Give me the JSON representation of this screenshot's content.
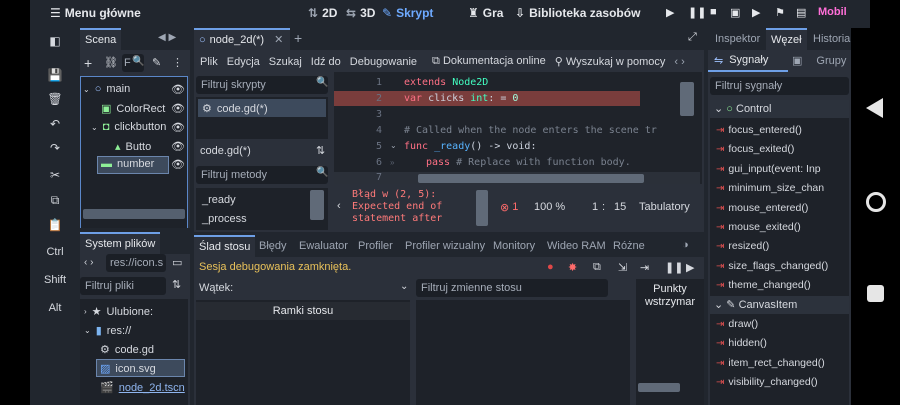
{
  "topbar": {
    "menu_label": "Menu główne",
    "tabs": [
      {
        "label": "2D"
      },
      {
        "label": "3D"
      },
      {
        "label": "Skrypt"
      },
      {
        "label": "Gra"
      },
      {
        "label": "Biblioteka zasobów"
      }
    ],
    "run_label": "Mobil"
  },
  "left_tools": {
    "ctrl": "Ctrl",
    "shift": "Shift",
    "alt": "Alt"
  },
  "scene": {
    "tab": "Scena",
    "tree": [
      {
        "label": "main"
      },
      {
        "label": "ColorRect"
      },
      {
        "label": "clickbutton"
      },
      {
        "label": "Butto"
      },
      {
        "label": "number"
      }
    ]
  },
  "filesystem": {
    "tab": "System plików",
    "path": "res://icon.s",
    "filter_placeholder": "Filtruj pliki",
    "favorites": "Ulubione:",
    "items": [
      {
        "label": "res://"
      },
      {
        "label": "code.gd"
      },
      {
        "label": "icon.svg"
      },
      {
        "label": "node_2d.tscn"
      }
    ]
  },
  "editor": {
    "tab_label": "node_2d(*)",
    "menu": [
      {
        "label": "Plik"
      },
      {
        "label": "Edycja"
      },
      {
        "label": "Szukaj"
      },
      {
        "label": "Idź do"
      },
      {
        "label": "Debugowanie"
      },
      {
        "label": "Dokumentacja online"
      },
      {
        "label": "Wyszukaj w pomocy"
      }
    ],
    "filter_scripts": "Filtruj skrypty",
    "script_item": "code.gd(*)",
    "current_script": "code.gd(*)",
    "filter_methods": "Filtruj metody",
    "methods": [
      {
        "label": "_ready"
      },
      {
        "label": "_process"
      }
    ],
    "line_numbers": [
      "1",
      "2",
      "3",
      "4",
      "5",
      "6",
      "7"
    ],
    "code": {
      "l1_kw": "extends",
      "l1_ty": "Node2D",
      "l2_kw": "var",
      "l2_a": "clicks",
      "l2_ty": "int",
      "l2_b": "=",
      "l2_n": "0",
      "l4": "# Called when the node enters the scene tr",
      "l5_kw": "func",
      "l5_fn": "_ready",
      "l5_rest": "() -> void:",
      "l6_kw": "pass",
      "l6_cm": "# Replace with function body."
    },
    "error": {
      "line1": "Błąd w (2, 5):",
      "line2": "Expected end of",
      "line3": "statement after"
    },
    "error_count": "1",
    "zoom": "100 %",
    "pos_line": "1",
    "pos_col": "15",
    "indent": "Tabulatory"
  },
  "bottom": {
    "tabs": [
      {
        "label": "Ślad stosu"
      },
      {
        "label": "Błędy"
      },
      {
        "label": "Ewaluator"
      },
      {
        "label": "Profiler"
      },
      {
        "label": "Profiler wizualny"
      },
      {
        "label": "Monitory"
      },
      {
        "label": "Wideo RAM"
      },
      {
        "label": "Różne"
      }
    ],
    "status": "Sesja debugowania zamknięta.",
    "thread_label": "Wątek:",
    "filter_vars": "Filtruj zmienne stosu",
    "frames": "Ramki stosu",
    "breakpoints": "Punkty wstrzymar"
  },
  "inspector": {
    "tabs": [
      {
        "label": "Inspektor"
      },
      {
        "label": "Węzeł"
      },
      {
        "label": "Historia"
      }
    ],
    "sub_tabs": [
      {
        "label": "Sygnały"
      },
      {
        "label": "Grupy"
      }
    ],
    "filter_placeholder": "Filtruj sygnały",
    "sections": [
      {
        "label": "Control"
      },
      {
        "label": "CanvasItem"
      }
    ],
    "signals_control": [
      {
        "label": "focus_entered()"
      },
      {
        "label": "focus_exited()"
      },
      {
        "label": "gui_input(event: Inp"
      },
      {
        "label": "minimum_size_chan"
      },
      {
        "label": "mouse_entered()"
      },
      {
        "label": "mouse_exited()"
      },
      {
        "label": "resized()"
      },
      {
        "label": "size_flags_changed()"
      },
      {
        "label": "theme_changed()"
      }
    ],
    "signals_canvas": [
      {
        "label": "draw()"
      },
      {
        "label": "hidden()"
      },
      {
        "label": "item_rect_changed()"
      },
      {
        "label": "visibility_changed()"
      }
    ]
  }
}
